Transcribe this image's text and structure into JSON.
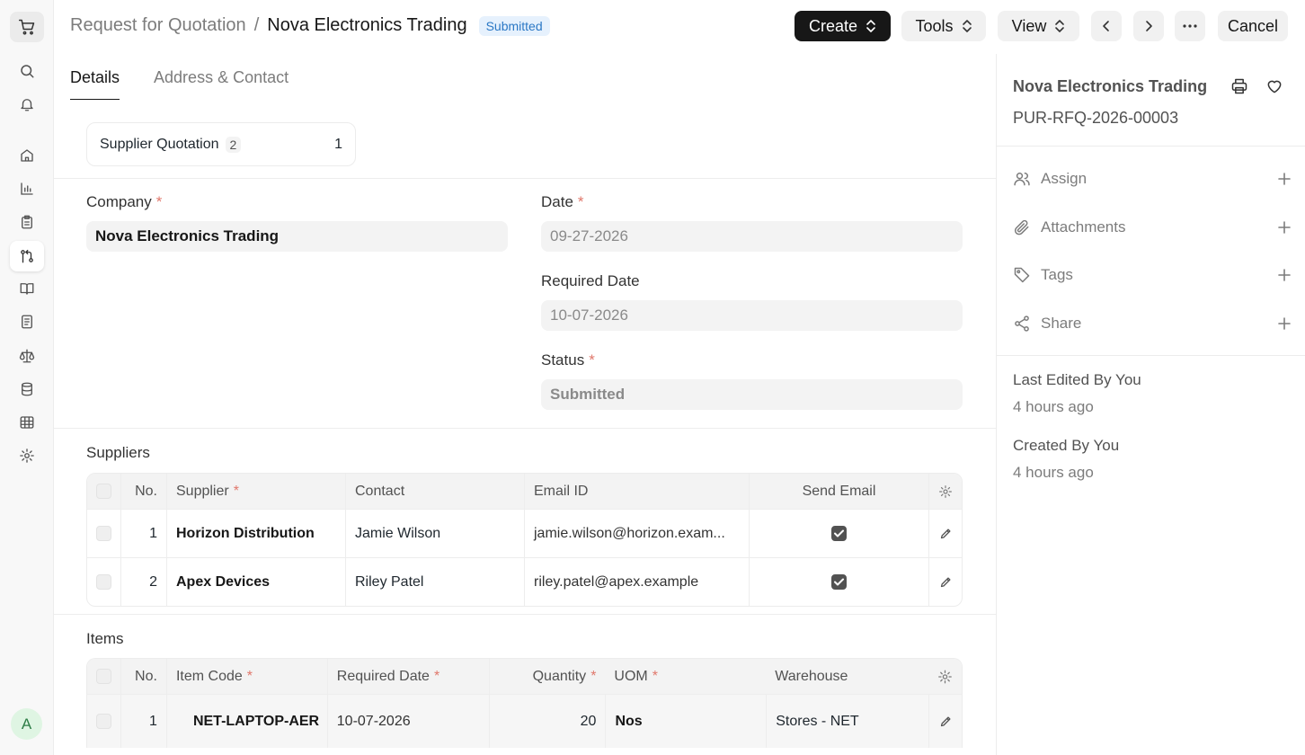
{
  "header": {
    "breadcrumb_parent": "Request for Quotation",
    "breadcrumb_separator": "/",
    "breadcrumb_current": "Nova Electronics Trading",
    "status_badge": "Submitted",
    "create_label": "Create",
    "tools_label": "Tools",
    "view_label": "View",
    "cancel_label": "Cancel"
  },
  "tabs": [
    {
      "label": "Details",
      "active": true
    },
    {
      "label": "Address & Contact",
      "active": false
    }
  ],
  "connections": {
    "label": "Supplier Quotation",
    "count": "2",
    "open": "1"
  },
  "form": {
    "company_label": "Company",
    "company_value": "Nova Electronics Trading",
    "date_label": "Date",
    "date_value": "09-27-2026",
    "required_date_label": "Required Date",
    "required_date_value": "10-07-2026",
    "status_label": "Status",
    "status_value": "Submitted"
  },
  "suppliers": {
    "title": "Suppliers",
    "columns": {
      "no": "No.",
      "supplier": "Supplier",
      "contact": "Contact",
      "email": "Email ID",
      "send_email": "Send Email"
    },
    "rows": [
      {
        "no": "1",
        "supplier": "Horizon Distribution",
        "contact": "Jamie Wilson",
        "email": "jamie.wilson@horizon.exam...",
        "send_email": true
      },
      {
        "no": "2",
        "supplier": "Apex Devices",
        "contact": "Riley Patel",
        "email": "riley.patel@apex.example",
        "send_email": true
      }
    ]
  },
  "items": {
    "title": "Items",
    "columns": {
      "no": "No.",
      "item_code": "Item Code",
      "required_date": "Required Date",
      "quantity": "Quantity",
      "uom": "UOM",
      "warehouse": "Warehouse"
    },
    "rows": [
      {
        "no": "1",
        "item_code": "NET-LAPTOP-AER",
        "required_date": "10-07-2026",
        "quantity": "20",
        "uom": "Nos",
        "warehouse": "Stores - NET"
      }
    ]
  },
  "sidebar": {
    "title": "Nova Electronics Trading",
    "doc_id": "PUR-RFQ-2026-00003",
    "assign_label": "Assign",
    "attachments_label": "Attachments",
    "tags_label": "Tags",
    "share_label": "Share",
    "last_edited_label": "Last Edited By You",
    "last_edited_time": "4 hours ago",
    "created_label": "Created By You",
    "created_time": "4 hours ago"
  },
  "user": {
    "avatar_initial": "A"
  },
  "colors": {
    "accent_dark": "#171717",
    "badge_bg": "#e6f1fd",
    "badge_text": "#2b78c5",
    "required": "#e0776b"
  }
}
